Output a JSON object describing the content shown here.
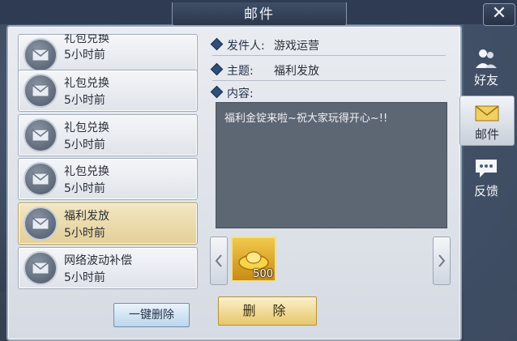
{
  "window": {
    "title": "邮件",
    "close_icon": "✕"
  },
  "mail_list": [
    {
      "title": "礼包兑换",
      "time": "5小时前",
      "selected": false
    },
    {
      "title": "礼包兑换",
      "time": "5小时前",
      "selected": false
    },
    {
      "title": "礼包兑换",
      "time": "5小时前",
      "selected": false
    },
    {
      "title": "礼包兑换",
      "time": "5小时前",
      "selected": false
    },
    {
      "title": "福利发放",
      "time": "5小时前",
      "selected": true
    },
    {
      "title": "网络波动补偿",
      "time": "5小时前",
      "selected": false
    }
  ],
  "actions": {
    "delete_all": "一键删除",
    "delete": "删 除"
  },
  "detail": {
    "sender_label": "发件人:",
    "sender_value": "游戏运营",
    "subject_label": "主题:",
    "subject_value": "福利发放",
    "content_label": "内容:",
    "content_text": "福利金锭来啦~祝大家玩得开心~!!"
  },
  "attachment": {
    "icon": "gold-ingot-icon",
    "count": "500"
  },
  "tabs": [
    {
      "label": "好友",
      "icon": "friends-icon",
      "active": false
    },
    {
      "label": "邮件",
      "icon": "mail-icon",
      "active": true
    },
    {
      "label": "反馈",
      "icon": "feedback-icon",
      "active": false
    }
  ],
  "colors": {
    "selected_item": "#e3cf98",
    "accent_gold": "#e7c76c",
    "content_bg": "#5d6673"
  }
}
